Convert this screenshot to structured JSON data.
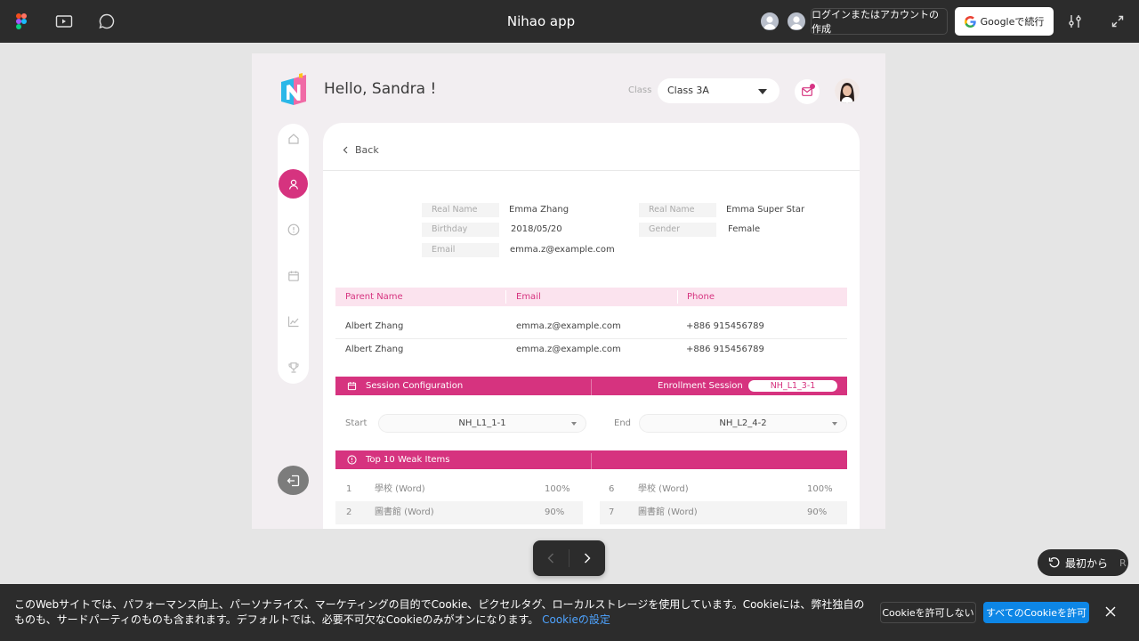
{
  "topbar": {
    "title": "Nihao app",
    "login_label": "ログインまたはアカウントの作成",
    "google_label": "Googleで続行",
    "icons": [
      "figma-logo-icon",
      "present-icon",
      "comment-icon",
      "settings-sliders-icon",
      "expand-icon"
    ]
  },
  "app": {
    "greeting": "Hello, Sandra !",
    "class_label": "Class",
    "class_value": "Class 3A",
    "back_label": "Back",
    "accent": "#d6337f"
  },
  "student": {
    "col1": [
      {
        "label": "Real Name",
        "value": "Emma Zhang"
      },
      {
        "label": "Birthday",
        "value": "2018/05/20"
      },
      {
        "label": "Email",
        "value": "emma.z@example.com"
      }
    ],
    "col2": [
      {
        "label": "Real Name",
        "value": "Emma Super Star"
      },
      {
        "label": "Gender",
        "value": "Female"
      }
    ]
  },
  "parents": {
    "headers": [
      "Parent Name",
      "Email",
      "Phone"
    ],
    "rows": [
      [
        "Albert Zhang",
        "emma.z@example.com",
        "+886 915456789"
      ],
      [
        "Albert Zhang",
        "emma.z@example.com",
        "+886 915456789"
      ]
    ]
  },
  "session": {
    "title": "Session Configuration",
    "enroll_label": "Enrollment Session",
    "enroll_value": "NH_L1_3-1",
    "start_label": "Start",
    "start_value": "NH_L1_1-1",
    "end_label": "End",
    "end_value": "NH_L2_4-2"
  },
  "weak": {
    "title": "Top 10 Weak Items",
    "left": [
      {
        "n": "1",
        "word": "學校 (Word)",
        "pct": "100%"
      },
      {
        "n": "2",
        "word": "圖書館 (Word)",
        "pct": "90%"
      }
    ],
    "right": [
      {
        "n": "6",
        "word": "學校 (Word)",
        "pct": "100%"
      },
      {
        "n": "7",
        "word": "圖書館 (Word)",
        "pct": "90%"
      }
    ]
  },
  "player": {
    "restart_label": "最初から",
    "restart_key": "R"
  },
  "cookie": {
    "text": "このWebサイトでは、パフォーマンス向上、パーソナライズ、マーケティングの目的でCookie、ピクセルタグ、ローカルストレージを使用しています。Cookieには、弊社独自のものも、サードパーティのものも含まれます。デフォルトでは、必要不可欠なCookieのみがオンになります。",
    "link": "Cookieの設定",
    "reject": "Cookieを許可しない",
    "accept": "すべてのCookieを許可"
  }
}
